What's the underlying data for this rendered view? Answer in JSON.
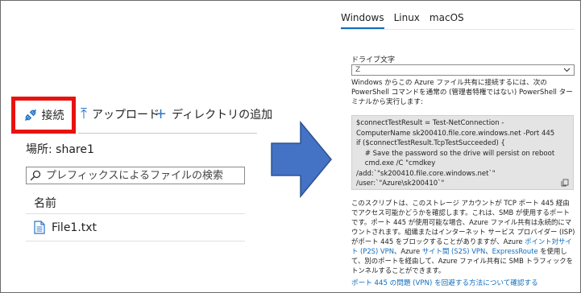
{
  "left_panel": {
    "toolbar": {
      "connect_label": "接続",
      "upload_label": "アップロード",
      "add_directory_label": "ディレクトリの追加"
    },
    "location": "場所: share1",
    "search_placeholder": "プレフィックスによるファイルの検索",
    "column_name": "名前",
    "files": [
      {
        "name": "File1.txt"
      }
    ]
  },
  "right_panel": {
    "os_tabs": [
      "Windows",
      "Linux",
      "macOS"
    ],
    "active_tab": "Windows",
    "drive_letter_label": "ドライブ文字",
    "drive_letter_value": "Z",
    "description": "Windows からこの Azure ファイル共有に接続するには、次の PowerShell コマンドを通常の (管理者特権ではない) PowerShell ターミナルから実行します:",
    "code_lines": [
      "$connectTestResult = Test-NetConnection -",
      "ComputerName sk200410.file.core.windows.net -Port 445",
      "if ($connectTestResult.TcpTestSucceeded) {",
      "    # Save the password so the drive will persist on reboot",
      "    cmd.exe /C \"cmdkey",
      "/add:`\"sk200410.file.core.windows.net`\"",
      "/user:`\"Azure\\sk200410`\""
    ],
    "note_part1": "このスクリプトは、このストレージ アカウントが TCP ポート 445 経由でアクセス可能かどうかを確認します。これは、SMB が使用するポートです。ポート 445 が使用可能な場合、Azure ファイル共有は永続的にマウントされます。組織またはインターネット サービス プロバイダー (ISP) がポート 445 をブロックすることがありますが、Azure ",
    "note_link1": "ポイント対サイト (P2S) VPN",
    "note_part2": "、Azure ",
    "note_link2": "サイト間 (S2S) VPN",
    "note_part3": "、",
    "note_link3": "ExpressRoute",
    "note_part4": " を使用して、別のポートを経由して、Azure ファイル共有に SMB トラフィックをトンネルすることができます。",
    "bottom_link": "ポート 445 の問題 (VPN) を回避する方法について確認する"
  },
  "colors": {
    "highlight_border": "#e8130f",
    "accent": "#0f6cbd",
    "arrow_fill": "#4472c4",
    "code_bg": "#e4e4e4"
  }
}
